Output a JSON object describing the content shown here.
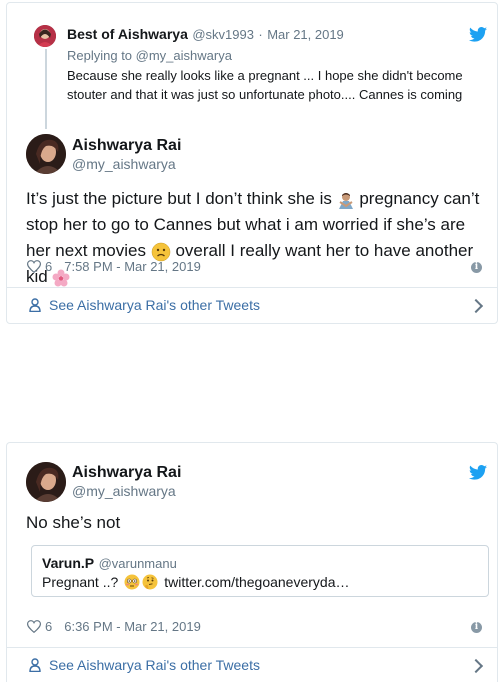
{
  "tweet1": {
    "reply": {
      "name": "Best of Aishwarya",
      "handle": "@skv1993",
      "separator": "·",
      "date": "Mar 21, 2019",
      "replying_to": "Replying to @my_aishwarya",
      "text": "Because she really looks like a pregnant ... I hope she didn't become stouter and that it was just so unfortunate photo.... Cannes is coming"
    },
    "author": {
      "name": "Aishwarya Rai",
      "handle": "@my_aishwarya"
    },
    "text_part1": "It’s just the picture but I don’t think she is",
    "text_part2": "pregnancy can’t stop her to go to Cannes but what i am worried if she’s are her next movies",
    "text_part3": "overall I really want her to have another kid",
    "likes": "6",
    "timestamp": "7:58 PM - Mar 21, 2019",
    "see_more": "See Aishwarya Rai's other Tweets"
  },
  "tweet2": {
    "author": {
      "name": "Aishwarya Rai",
      "handle": "@my_aishwarya"
    },
    "text": "No she’s not",
    "quote": {
      "name": "Varun.P",
      "handle": "@varunmanu",
      "text": "Pregnant ..?",
      "link": "twitter.com/thegoaneveryda…"
    },
    "likes": "6",
    "timestamp": "6:36 PM - Mar 21, 2019",
    "see_more": "See Aishwarya Rai's other Tweets"
  },
  "colors": {
    "twitter_blue": "#1da1f2",
    "link": "#3b6ea5",
    "meta": "#657786"
  },
  "icons": [
    "twitter-bird-icon",
    "heart-icon",
    "info-icon",
    "user-icon",
    "chevron-right-icon"
  ]
}
